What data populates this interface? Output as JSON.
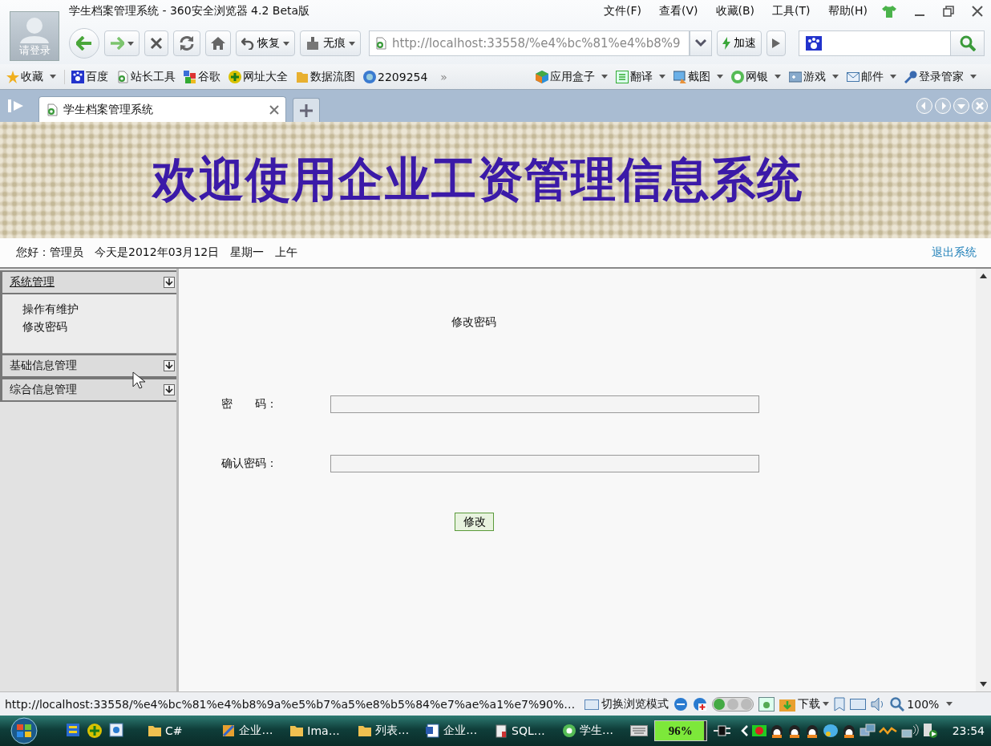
{
  "window": {
    "title": "学生档案管理系统 - 360安全浏览器 4.2 Beta版",
    "menus": [
      "文件(F)",
      "查看(V)",
      "收藏(B)",
      "工具(T)",
      "帮助(H)"
    ]
  },
  "account": {
    "label": "请登录"
  },
  "toolbar": {
    "restore": "恢复",
    "incognito": "无痕",
    "address": "http://localhost:33558/%e4%bc%81%e4%b8%9",
    "accelerate": "加速"
  },
  "bookmarks": {
    "items": [
      "收藏",
      "百度",
      "站长工具",
      "谷歌",
      "网址大全",
      "数据流图",
      "2209254"
    ],
    "more": "»",
    "tools": [
      "应用盒子",
      "翻译",
      "截图",
      "网银",
      "游戏",
      "邮件",
      "登录管家"
    ]
  },
  "tabs": [
    {
      "label": "学生档案管理系统",
      "selected": true
    }
  ],
  "banner": {
    "title": "欢迎使用企业工资管理信息系统"
  },
  "info": {
    "greeting": "您好：管理员",
    "date": "今天是2012年03月12日",
    "weekday": "星期一",
    "period": "上午",
    "logout": "退出系统"
  },
  "sidebar": {
    "sections": [
      {
        "title": "系统管理",
        "expanded": true,
        "children": [
          {
            "label": "操作有维护"
          },
          {
            "label": "修改密码"
          }
        ]
      },
      {
        "title": "基础信息管理",
        "expanded": false
      },
      {
        "title": "综合信息管理",
        "expanded": false
      }
    ]
  },
  "form": {
    "title": "修改密码",
    "fields": [
      {
        "label": "密　　码："
      },
      {
        "label": "确认密码："
      }
    ],
    "submit": "修改"
  },
  "status_bar": {
    "url": "http://localhost:33558/%e4%bc%81%e4%b8%9a%e5%b7%a5%e8%b5%84%e7%ae%a1%e7%90%…",
    "mode": "切换浏览模式",
    "download": "下载",
    "zoom": "100%"
  },
  "taskbar": {
    "items": [
      "C#",
      "企业…",
      "Ima…",
      "列表…",
      "企业…",
      "SQL…",
      "学生…"
    ],
    "battery": {
      "label": "96%",
      "level": 0.96
    },
    "clock": "23:54"
  }
}
